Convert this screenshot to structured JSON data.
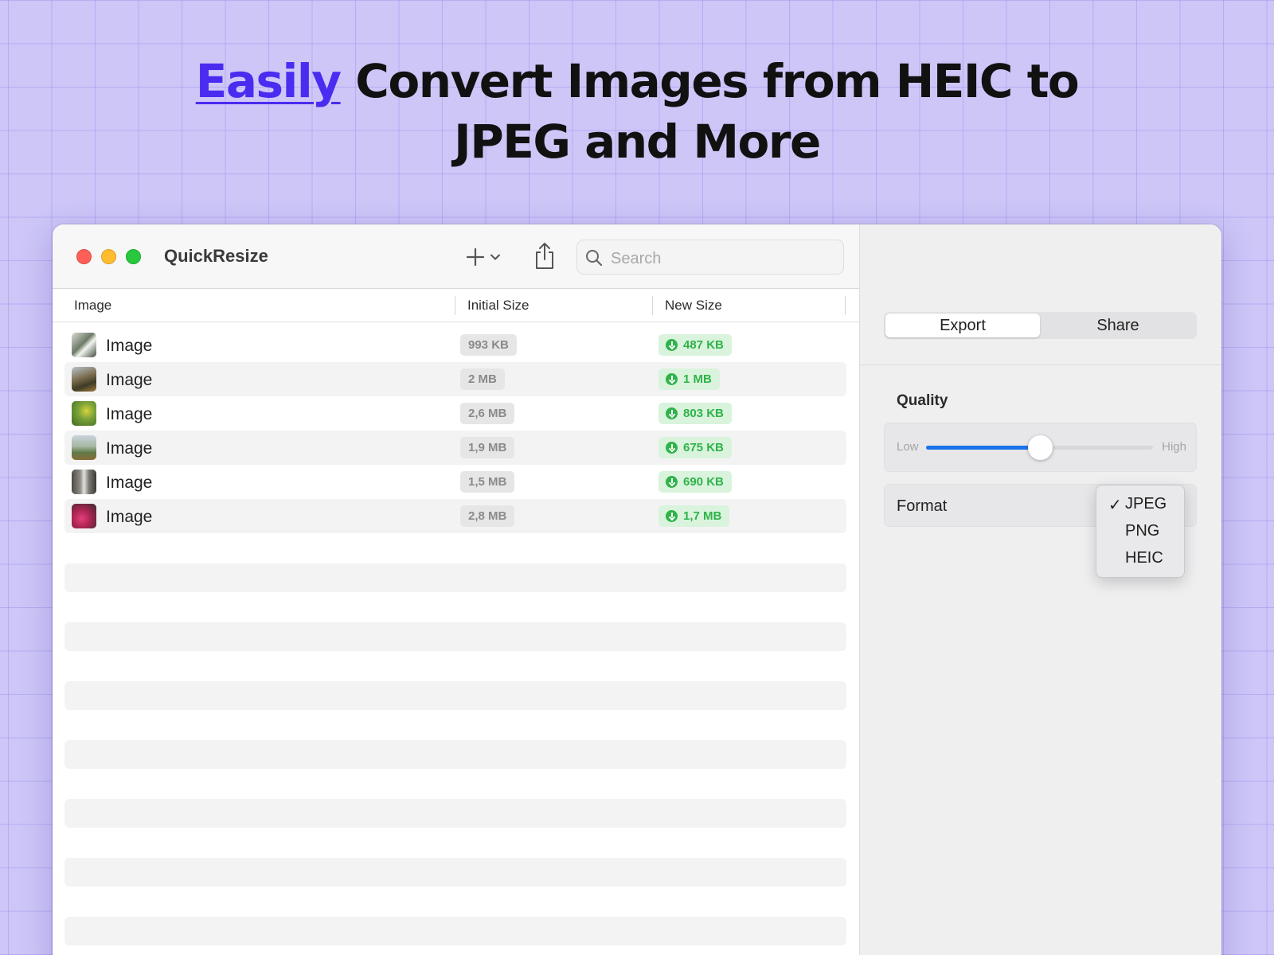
{
  "headline": {
    "accent_word": "Easily",
    "rest_line1": " Convert Images from HEIC to",
    "line2": "JPEG and More"
  },
  "window": {
    "app_title": "QuickResize",
    "search_placeholder": "Search",
    "columns": [
      "Image",
      "Initial Size",
      "New Size"
    ],
    "rows": [
      {
        "name": "Image",
        "initial_size": "993 KB",
        "new_size": "487 KB"
      },
      {
        "name": "Image",
        "initial_size": "2 MB",
        "new_size": "1 MB"
      },
      {
        "name": "Image",
        "initial_size": "2,6 MB",
        "new_size": "803 KB"
      },
      {
        "name": "Image",
        "initial_size": "1,9 MB",
        "new_size": "675 KB"
      },
      {
        "name": "Image",
        "initial_size": "1,5 MB",
        "new_size": "690 KB"
      },
      {
        "name": "Image",
        "initial_size": "2,8 MB",
        "new_size": "1,7 MB"
      }
    ]
  },
  "sidebar": {
    "tabs": [
      "Export",
      "Share"
    ],
    "active_tab": "Export",
    "quality": {
      "title": "Quality",
      "low_label": "Low",
      "high_label": "High",
      "value": 0.5
    },
    "format": {
      "label": "Format",
      "options": [
        "JPEG",
        "PNG",
        "HEIC"
      ],
      "selected": "JPEG",
      "check_mark": "✓"
    }
  },
  "colors": {
    "accent": "#4a2cf0",
    "slider": "#1a73e8",
    "new_size_green": "#2fb34a",
    "traffic_close": "#fe5f57",
    "traffic_min": "#febc2e",
    "traffic_max": "#28c840"
  },
  "icons": [
    "plus-icon",
    "chevron-down-icon",
    "share-icon",
    "search-icon",
    "download-arrow-icon",
    "checkmark-icon"
  ]
}
